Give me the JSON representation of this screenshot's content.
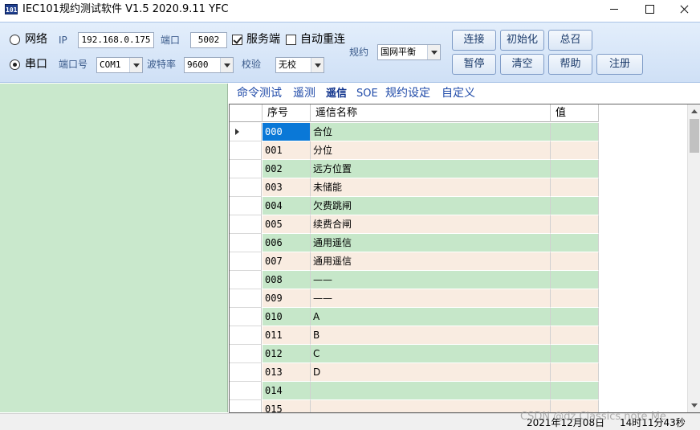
{
  "window": {
    "app_icon_text": "101",
    "title": "IEC101规约测试软件  V1.5 2020.9.11   YFC"
  },
  "toolbar": {
    "network_label": "网络",
    "ip_label": "IP",
    "ip_value": "192.168.0.175",
    "port_label": "端口",
    "port_value": "5002",
    "server_label": "服务端",
    "reconnect_label": "自动重连",
    "serial_label": "串口",
    "com_label": "端口号",
    "com_value": "COM1",
    "baud_label": "波特率",
    "baud_value": "9600",
    "parity_label": "校验",
    "parity_value": "无校",
    "protocol_label": "规约",
    "protocol_value": "国网平衡",
    "buttons": {
      "connect": "连接",
      "init": "初始化",
      "general_call": "总召",
      "pause": "暂停",
      "clear": "清空",
      "help": "帮助",
      "register": "注册"
    },
    "mode": "serial",
    "server_checked": true,
    "reconnect_checked": false
  },
  "tabs": [
    "命令测试",
    "遥测",
    "遥信",
    "SOE",
    "规约设定",
    "自定义"
  ],
  "active_tab": "遥信",
  "grid": {
    "headers": [
      "序号",
      "遥信名称",
      "值"
    ],
    "rows": [
      {
        "index": "000",
        "name": "合位",
        "value": ""
      },
      {
        "index": "001",
        "name": "分位",
        "value": ""
      },
      {
        "index": "002",
        "name": "远方位置",
        "value": ""
      },
      {
        "index": "003",
        "name": "未储能",
        "value": ""
      },
      {
        "index": "004",
        "name": "欠费跳闸",
        "value": ""
      },
      {
        "index": "005",
        "name": "续费合闸",
        "value": ""
      },
      {
        "index": "006",
        "name": "通用遥信",
        "value": ""
      },
      {
        "index": "007",
        "name": "通用遥信",
        "value": ""
      },
      {
        "index": "008",
        "name": "——",
        "value": ""
      },
      {
        "index": "009",
        "name": "——",
        "value": ""
      },
      {
        "index": "010",
        "name": "A",
        "value": ""
      },
      {
        "index": "011",
        "name": "B",
        "value": ""
      },
      {
        "index": "012",
        "name": "C",
        "value": ""
      },
      {
        "index": "013",
        "name": "D",
        "value": ""
      },
      {
        "index": "014",
        "name": "",
        "value": ""
      },
      {
        "index": "015",
        "name": "",
        "value": ""
      }
    ],
    "selected_row": 0
  },
  "status": {
    "date": "2021年12月08日",
    "time": "14时11分43秒"
  },
  "watermark": "CSDN @dz Classics note Me",
  "colors": {
    "row_green": "#c6e7c9",
    "row_peach": "#f9ece1",
    "selection": "#0a78d7",
    "left_panel": "#c9e8cc"
  }
}
